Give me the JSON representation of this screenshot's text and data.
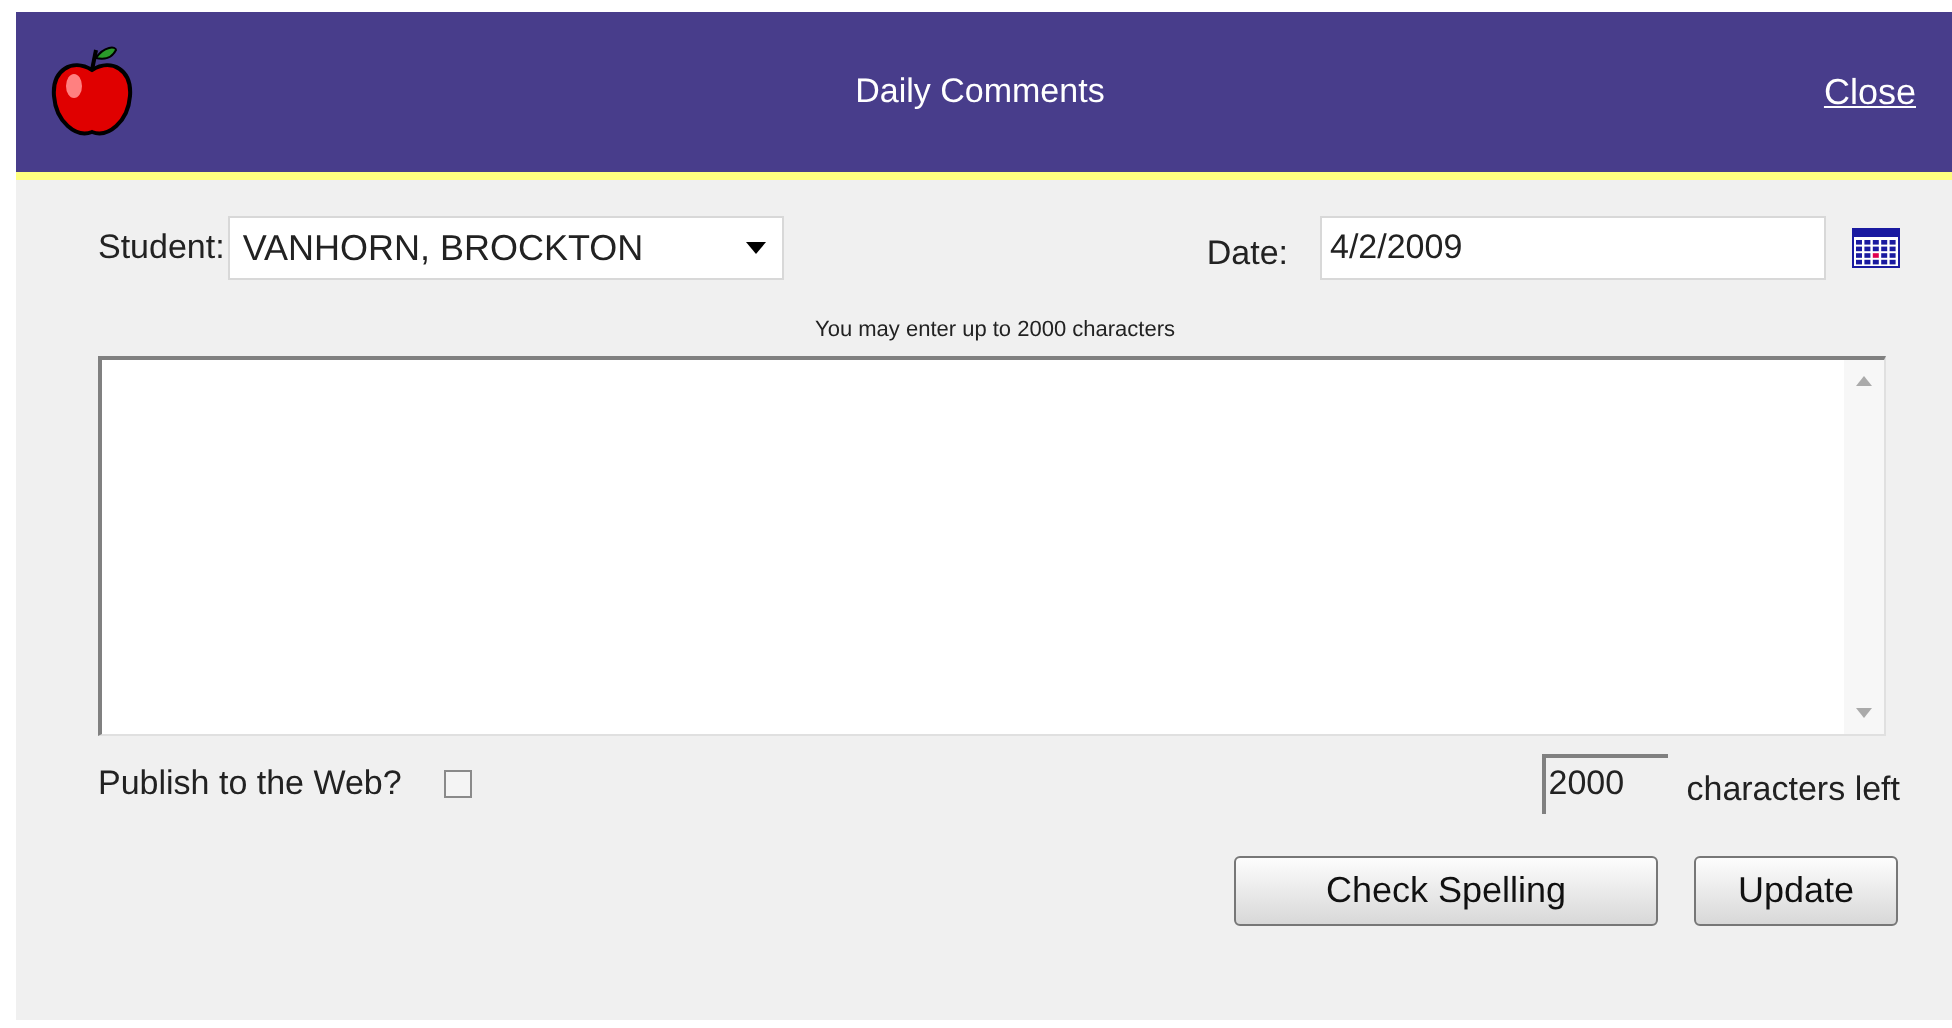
{
  "header": {
    "title": "Daily Comments",
    "close": "Close"
  },
  "student": {
    "label": "Student:",
    "value": "VANHORN, BROCKTON"
  },
  "date": {
    "label": "Date:",
    "value": "4/2/2009"
  },
  "comment": {
    "hint": "You may enter up to 2000 characters"
  },
  "publish": {
    "label": "Publish to the Web?",
    "checked": false
  },
  "counter": {
    "value": "2000",
    "label": "characters left"
  },
  "buttons": [
    "Check Spelling",
    "Update"
  ]
}
